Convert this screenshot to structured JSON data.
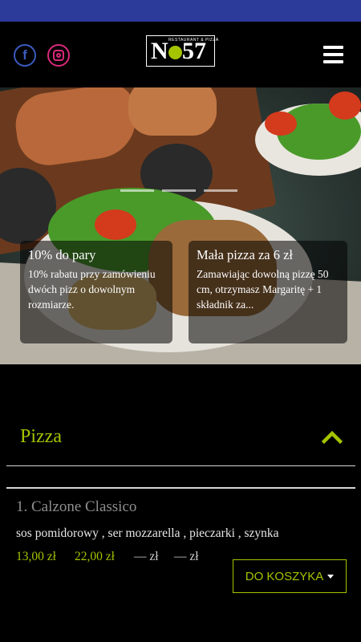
{
  "header": {
    "social": [
      {
        "icon": "facebook-icon"
      },
      {
        "icon": "instagram-icon"
      }
    ],
    "logo": {
      "main_left": "N",
      "main_right": "57",
      "subtitle": "RESTAURANT & PIZZA"
    },
    "menu_icon": "hamburger-menu-icon"
  },
  "hero": {
    "slider_indicator_count": 3,
    "promos": [
      {
        "title": "10% do pary",
        "text": "10% rabatu przy zamówieniu dwóch pizz o dowolnym rozmiarze."
      },
      {
        "title": "Mała pizza za 6 zł",
        "text": "Zamawiając dowolną pizzę 50 cm, otrzymasz Margaritę + 1 składnik za..."
      }
    ]
  },
  "category": {
    "title": "Pizza",
    "toggle_icon": "chevron-up-icon"
  },
  "items": [
    {
      "name": "1. Calzone Classico",
      "description": "sos pomidorowy , ser mozzarella , pieczarki , szynka",
      "prices": [
        "13,00 zł",
        "22,00 zł",
        "— zł",
        "— zł"
      ],
      "cart_label": "DO KOSZYKA"
    }
  ],
  "colors": {
    "accent": "#a4c400",
    "status_bar": "#2c3a9a",
    "facebook": "#3b5bbf",
    "instagram": "#d9287a"
  }
}
